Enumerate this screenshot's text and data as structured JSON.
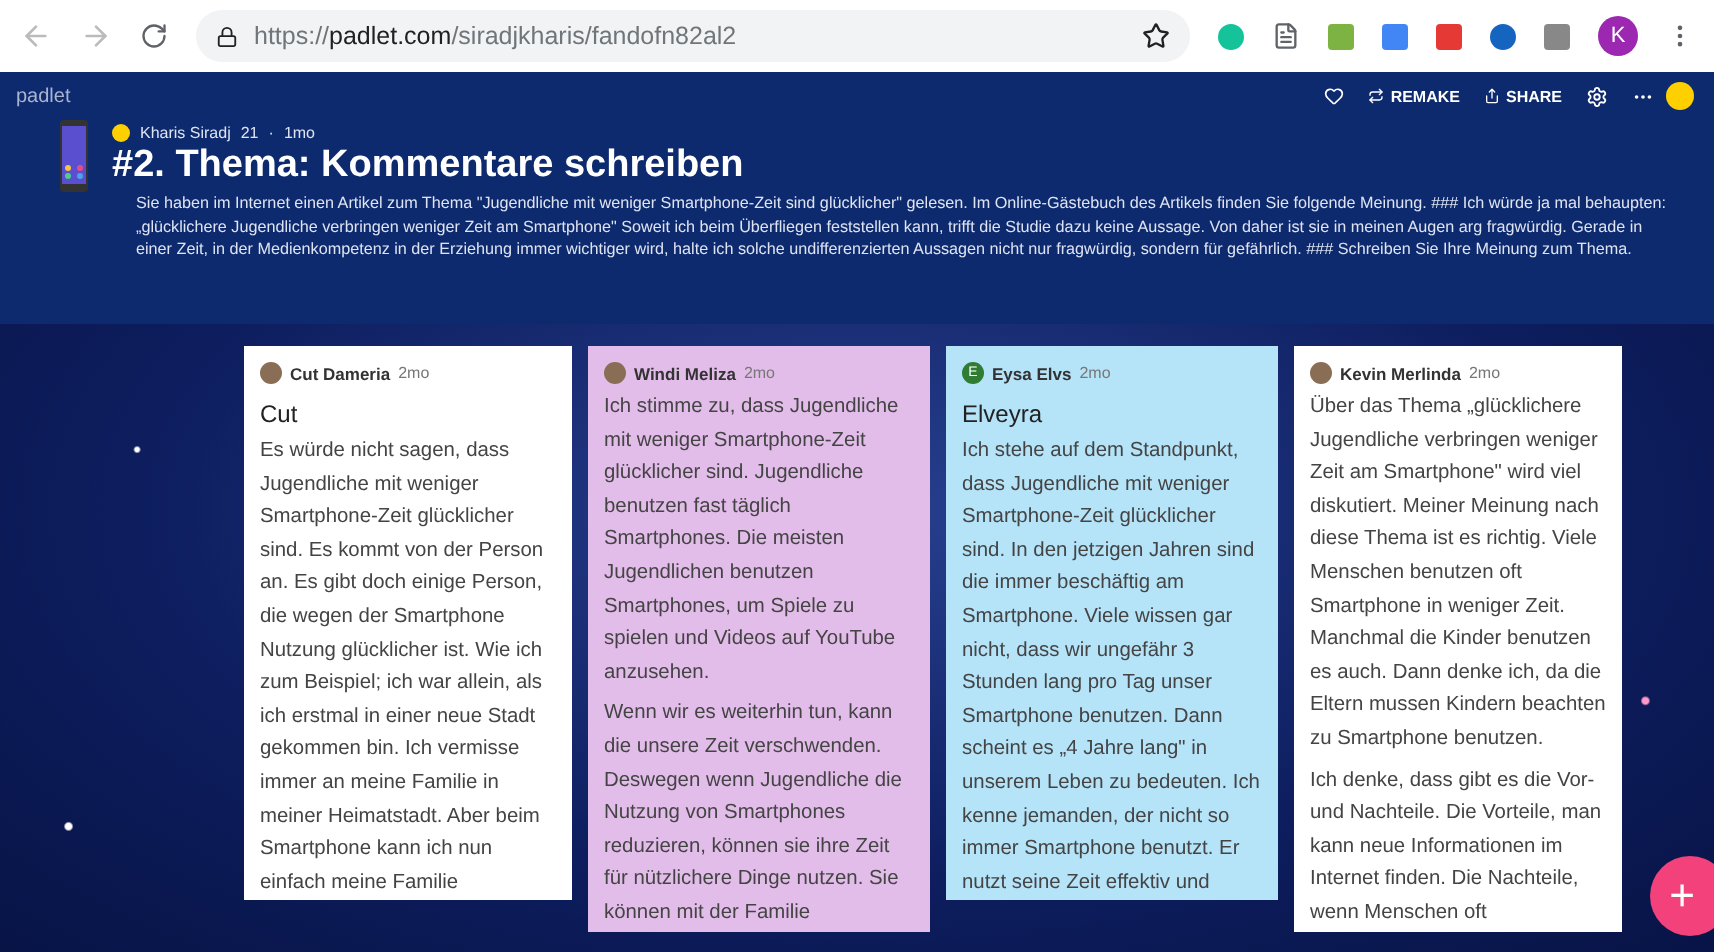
{
  "browser": {
    "url": {
      "scheme": "https://",
      "domain": "padlet.com",
      "path": "/siradjkharis/fandofn82al2"
    },
    "profile_initial": "K"
  },
  "header": {
    "logo": "padlet",
    "buttons": [
      {
        "label": "REMAKE"
      },
      {
        "label": "SHARE"
      }
    ]
  },
  "board": {
    "author": "Kharis Siradj",
    "likes": "21",
    "separator": "·",
    "time": "1mo",
    "title": "#2. Thema: Kommentare schreiben",
    "description": "Sie haben im Internet einen Artikel zum Thema \"Jugendliche mit weniger Smartphone-Zeit sind glücklicher\" gelesen. Im Online-Gästebuch des Artikels finden Sie folgende Meinung. ### Ich würde ja mal behaupten: „glücklichere Jugendliche verbringen weniger Zeit am Smartphone\" Soweit ich beim Überfliegen feststellen kann, trifft die Studie dazu keine Aussage. Von daher ist sie in meinen Augen arg fragwürdig. Gerade in einer Zeit, in der Medienkompetenz in der Erziehung immer wichtiger wird, halte ich solche undifferenzierten Aussagen nicht nur fragwürdig, sondern für gefährlich. ### Schreiben Sie Ihre Meinung zum Thema."
  },
  "posts": [
    {
      "author": "Cut Dameria",
      "time": "2mo",
      "color": "#ffffff",
      "avatar": {
        "kind": "photo"
      },
      "title": "Cut",
      "paragraphs": [
        "Es würde nicht sagen, dass Jugendliche mit weniger Smartphone-Zeit glücklicher sind. Es kommt von der Person an. Es gibt doch einige Person, die wegen der Smartphone Nutzung glücklicher ist. Wie ich zum Beispiel; ich war allein, als ich erstmal in einer neue Stadt gekommen bin. Ich vermisse immer an meine Familie in meiner Heimatstadt. Aber beim Smartphone kann ich nun einfach meine Familie"
      ]
    },
    {
      "author": "Windi Meliza",
      "time": "2mo",
      "color": "#e3bdea",
      "avatar": {
        "kind": "photo"
      },
      "paragraphs": [
        "Ich stimme zu, dass Jugendliche mit weniger Smartphone-Zeit glücklicher sind. Jugendliche benutzen fast täglich Smartphones. Die meisten Jugendlichen benutzen Smartphones, um Spiele zu spielen und Videos auf YouTube anzusehen.",
        "Wenn wir es weiterhin tun, kann die unsere Zeit verschwenden. Deswegen wenn Jugendliche die Nutzung von Smartphones reduzieren, können sie ihre Zeit für nützlichere Dinge nutzen. Sie können mit der Familie"
      ]
    },
    {
      "author": "Eysa Elvs",
      "time": "2mo",
      "color": "#b5e3f8",
      "avatar": {
        "kind": "letter",
        "initial": "E"
      },
      "title": "Elveyra",
      "paragraphs": [
        "Ich stehe auf dem Standpunkt, dass Jugendliche mit weniger Smartphone-Zeit glücklicher sind. In den jetzigen Jahren sind die immer beschäftig am Smartphone. Viele wissen gar nicht, dass wir ungefähr 3 Stunden lang pro Tag unser Smartphone benutzen. Dann scheint es „4 Jahre lang\" in unserem Leben zu bedeuten. Ich kenne jemanden, der nicht so immer Smartphone benutzt. Er nutzt seine Zeit effektiv  und"
      ]
    },
    {
      "author": "Kevin Merlinda",
      "time": "2mo",
      "color": "#ffffff",
      "avatar": {
        "kind": "photo"
      },
      "paragraphs": [
        "Über das Thema „glücklichere Jugendliche verbringen weniger Zeit am Smartphone\" wird viel diskutiert. Meiner Meinung nach diese Thema ist es richtig. Viele Menschen benutzen oft Smartphone in weniger Zeit. Manchmal die Kinder benutzen es auch. Dann denke ich, da die Eltern mussen Kindern beachten zu Smartphone benutzen.",
        "Ich denke, dass gibt es die Vor- und Nachteile. Die Vorteile, man kann neue Informationen im Internet finden. Die Nachteile, wenn Menschen oft"
      ]
    }
  ],
  "fab": {
    "label": "+"
  }
}
